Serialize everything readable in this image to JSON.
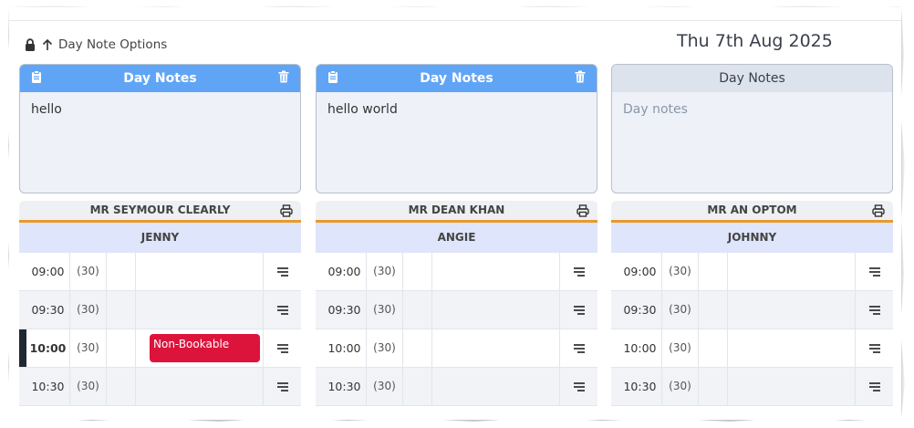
{
  "header": {
    "options_label": "Day Note Options",
    "date": "Thu 7th Aug 2025"
  },
  "columns": [
    {
      "note_title": "Day Notes",
      "note_text": "hello",
      "note_style": "active",
      "doctor": "MR SEYMOUR CLEARLY",
      "staff": "JENNY",
      "slots": [
        {
          "time": "09:00",
          "duration": "(30)"
        },
        {
          "time": "09:30",
          "duration": "(30)"
        },
        {
          "time": "10:00",
          "duration": "(30)",
          "current": true,
          "booking": "Non-Bookable"
        },
        {
          "time": "10:30",
          "duration": "(30)"
        }
      ]
    },
    {
      "note_title": "Day Notes",
      "note_text": "hello world",
      "note_style": "active",
      "doctor": "MR DEAN KHAN",
      "staff": "ANGIE",
      "slots": [
        {
          "time": "09:00",
          "duration": "(30)"
        },
        {
          "time": "09:30",
          "duration": "(30)"
        },
        {
          "time": "10:00",
          "duration": "(30)"
        },
        {
          "time": "10:30",
          "duration": "(30)"
        }
      ]
    },
    {
      "note_title": "Day Notes",
      "note_placeholder": "Day notes",
      "note_style": "inactive",
      "doctor": "MR AN OPTOM",
      "staff": "JOHNNY",
      "slots": [
        {
          "time": "09:00",
          "duration": "(30)"
        },
        {
          "time": "09:30",
          "duration": "(30)"
        },
        {
          "time": "10:00",
          "duration": "(30)"
        },
        {
          "time": "10:30",
          "duration": "(30)"
        }
      ]
    }
  ],
  "colors": {
    "note_header_active": "#60a5f5",
    "note_header_inactive": "#dde3ec",
    "doctor_underline": "#e79a2c",
    "non_bookable": "#dc143c",
    "current_time_marker": "#1f2733"
  },
  "icons": [
    "lock-icon",
    "arrow-up-icon",
    "clipboard-icon",
    "trash-icon",
    "printer-icon",
    "menu-lines-icon"
  ]
}
